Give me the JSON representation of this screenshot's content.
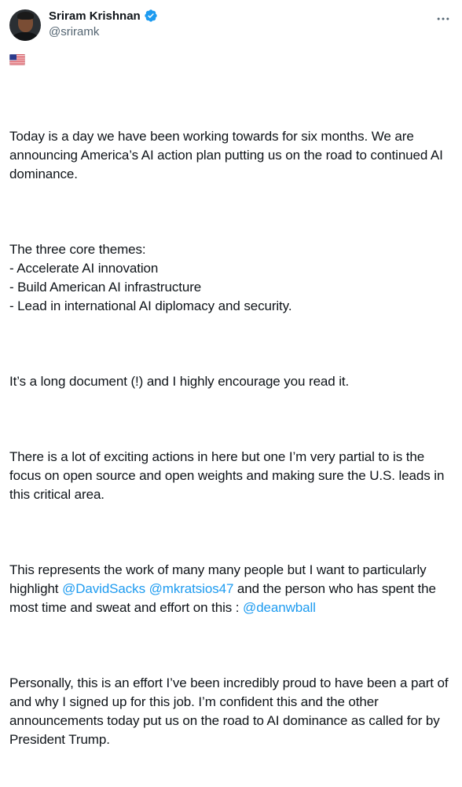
{
  "author": {
    "display_name": "Sriram Krishnan",
    "handle": "@sriramk",
    "verified_icon": "verified-badge-icon",
    "more_icon": "more-options-icon"
  },
  "colors": {
    "text": "#0f1419",
    "secondary": "#536471",
    "link": "#1d9bf0"
  },
  "flag_emoji": "us-flag-icon",
  "tweet": {
    "p1": "Today is a day we have been working towards for six months. We are announcing America’s AI action plan putting us on the road to continued AI dominance.",
    "p2": "The three core themes:\n- Accelerate AI innovation\n- Build American AI infrastructure\n- Lead in international AI diplomacy and security.",
    "p3": "It’s a long document (!) and I highly encourage you read it.",
    "p4": "There is a lot of exciting actions in here but one I’m very partial to is the focus on open source and open weights and making sure the U.S. leads in this critical area.",
    "p5_before": "This represents the work of many many people but I want to particularly highlight ",
    "mention_1": "@DavidSacks",
    "p5_space": " ",
    "mention_2": "@mkratsios47",
    "p5_middle": " and the person who has spent the most time and sweat and effort on this : ",
    "mention_3": "@deanwball",
    "p6": "Personally, this is an effort I’ve been incredibly proud to have been a part of and why I signed up for this job. I’m confident this and the other announcements today put us on the road to AI dominance as called for by President Trump."
  }
}
